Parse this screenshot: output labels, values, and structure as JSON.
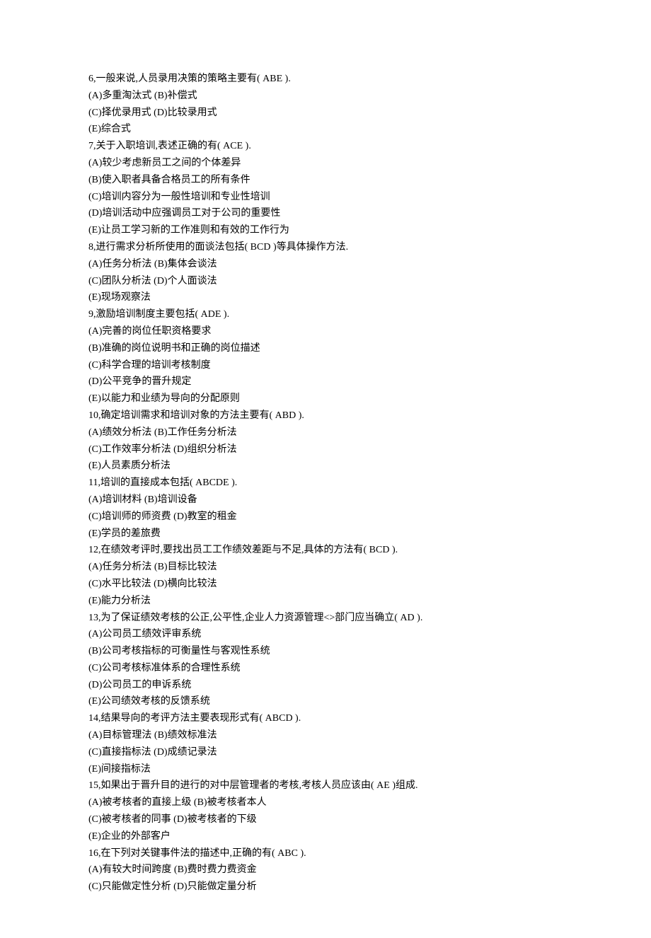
{
  "lines": [
    "6,一般来说,人员录用决策的策略主要有( ABE ).",
    "(A)多重淘汰式  (B)补偿式",
    "(C)择优录用式  (D)比较录用式",
    "(E)综合式",
    "7,关于入职培训,表述正确的有( ACE ).",
    "(A)较少考虑新员工之间的个体差异",
    "(B)使入职者具备合格员工的所有条件",
    "(C)培训内容分为一般性培训和专业性培训",
    "(D)培训活动中应强调员工对于公司的重要性",
    "(E)让员工学习新的工作准则和有效的工作行为",
    "8,进行需求分析所使用的面谈法包括( BCD )等具体操作方法.",
    "(A)任务分析法  (B)集体会谈法",
    "(C)团队分析法  (D)个人面谈法",
    "(E)现场观察法",
    "9,激励培训制度主要包括( ADE ).",
    "(A)完善的岗位任职资格要求",
    "(B)准确的岗位说明书和正确的岗位描述",
    "(C)科学合理的培训考核制度",
    "(D)公平竞争的晋升规定",
    "(E)以能力和业绩为导向的分配原则",
    "10,确定培训需求和培训对象的方法主要有( ABD ).",
    "(A)绩效分析法  (B)工作任务分析法",
    "(C)工作效率分析法  (D)组织分析法",
    "(E)人员素质分析法",
    "11,培训的直接成本包括( ABCDE ).",
    "(A)培训材料  (B)培训设备",
    "(C)培训师的师资费  (D)教室的租金",
    "(E)学员的差旅费",
    "12,在绩效考评时,要找出员工工作绩效差距与不足,具体的方法有( BCD ).",
    "(A)任务分析法  (B)目标比较法",
    "(C)水平比较法  (D)横向比较法",
    "(E)能力分析法",
    "13,为了保证绩效考核的公正,公平性,企业人力资源管理<>部门应当确立( AD ).",
    "(A)公司员工绩效评审系统",
    "(B)公司考核指标的可衡量性与客观性系统",
    "(C)公司考核标准体系的合理性系统",
    "(D)公司员工的申诉系统",
    "(E)公司绩效考核的反馈系统",
    "14,结果导向的考评方法主要表现形式有( ABCD ).",
    "(A)目标管理法  (B)绩效标准法",
    "(C)直接指标法  (D)成绩记录法",
    "(E)间接指标法",
    "15,如果出于晋升目的进行的对中层管理者的考核,考核人员应该由( AE )组成.",
    "(A)被考核者的直接上级  (B)被考核者本人",
    "(C)被考核者的同事  (D)被考核者的下级",
    "(E)企业的外部客户",
    "16,在下列对关键事件法的描述中,正确的有( ABC ).",
    "(A)有较大时间跨度  (B)费时费力费资金",
    "(C)只能做定性分析  (D)只能做定量分析"
  ]
}
